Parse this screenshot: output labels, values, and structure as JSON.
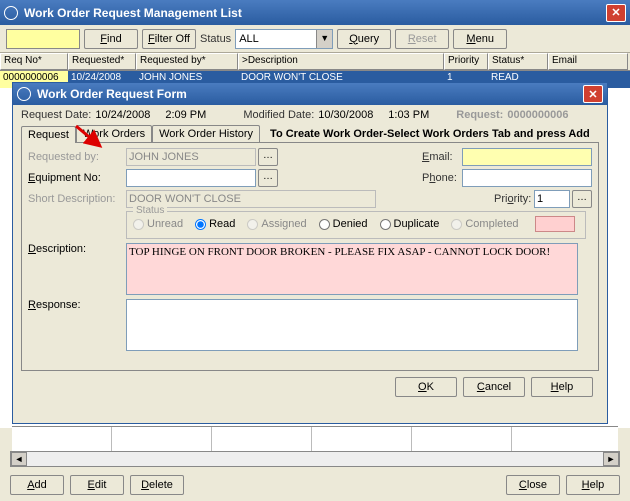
{
  "main": {
    "title": "Work Order Request Management List",
    "toolbar": {
      "find": "Find",
      "filter_off": "Filter Off",
      "status_label": "Status",
      "status_value": "ALL",
      "query": "Query",
      "reset": "Reset",
      "menu": "Menu"
    },
    "grid": {
      "headers": {
        "req_no": "Req No*",
        "requested": "Requested*",
        "requested_by": "Requested by*",
        "description": ">Description",
        "priority": "Priority",
        "status": "Status*",
        "email": "Email"
      },
      "row": {
        "req_no": "0000000006",
        "requested": "10/24/2008",
        "requested_by": "JOHN JONES",
        "description": "DOOR WON'T CLOSE",
        "priority": "1",
        "status": "READ",
        "email": ""
      }
    },
    "bottom": {
      "add": "Add",
      "edit": "Edit",
      "delete": "Delete",
      "close": "Close",
      "help": "Help"
    }
  },
  "modal": {
    "title": "Work Order Request Form",
    "request_date_lbl": "Request Date:",
    "request_date": "10/24/2008",
    "request_time": "2:09 PM",
    "modified_date_lbl": "Modified Date:",
    "modified_date": "10/30/2008",
    "modified_time": "1:03 PM",
    "request_lbl": "Request:",
    "request_no": "0000000006",
    "tabs": {
      "request": "Request",
      "work_orders": "Work Orders",
      "history": "Work Order History"
    },
    "tab_message": "To Create Work Order-Select Work Orders Tab and press Add",
    "form": {
      "requested_by_lbl": "Requested by:",
      "requested_by": "JOHN JONES",
      "email_lbl": "Email:",
      "email": "",
      "equipment_lbl": "Equipment No:",
      "equipment": "",
      "phone_lbl": "Phone:",
      "phone": "",
      "short_desc_lbl": "Short Description:",
      "short_desc": "DOOR WON'T CLOSE",
      "priority_lbl": "Priority:",
      "priority": "1",
      "status_lbl": "Status",
      "radios": {
        "unread": "Unread",
        "read": "Read",
        "assigned": "Assigned",
        "denied": "Denied",
        "duplicate": "Duplicate",
        "completed": "Completed"
      },
      "description_lbl": "Description:",
      "description": "TOP HINGE ON FRONT DOOR BROKEN - PLEASE FIX ASAP - CANNOT LOCK DOOR!",
      "response_lbl": "Response:",
      "response": ""
    },
    "buttons": {
      "ok": "OK",
      "cancel": "Cancel",
      "help": "Help"
    }
  }
}
